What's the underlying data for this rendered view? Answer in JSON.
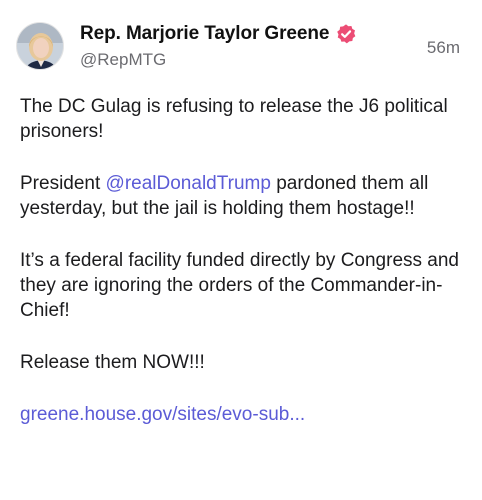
{
  "author": {
    "display_name": "Rep. Marjorie Taylor Greene",
    "handle": "@RepMTG",
    "verified_icon": "verified-badge-icon",
    "avatar_icon": "profile-avatar"
  },
  "post": {
    "timestamp": "56m",
    "paragraphs": {
      "p1": "The DC Gulag is refusing to release the J6 political prisoners!",
      "p2_before": "President ",
      "p2_mention": "@realDonaldTrump",
      "p2_after": " pardoned them all yesterday, but the jail is holding them hostage!!",
      "p3": "It’s a federal facility funded directly by Congress and they are ignoring the orders of the Commander-in-Chief!",
      "p4": "Release them NOW!!!"
    },
    "link_text": "greene.house.gov/sites/evo-sub..."
  },
  "colors": {
    "link": "#5b5bd6",
    "verified_badge": "#ec4d75",
    "secondary_text": "#6b6b70"
  }
}
